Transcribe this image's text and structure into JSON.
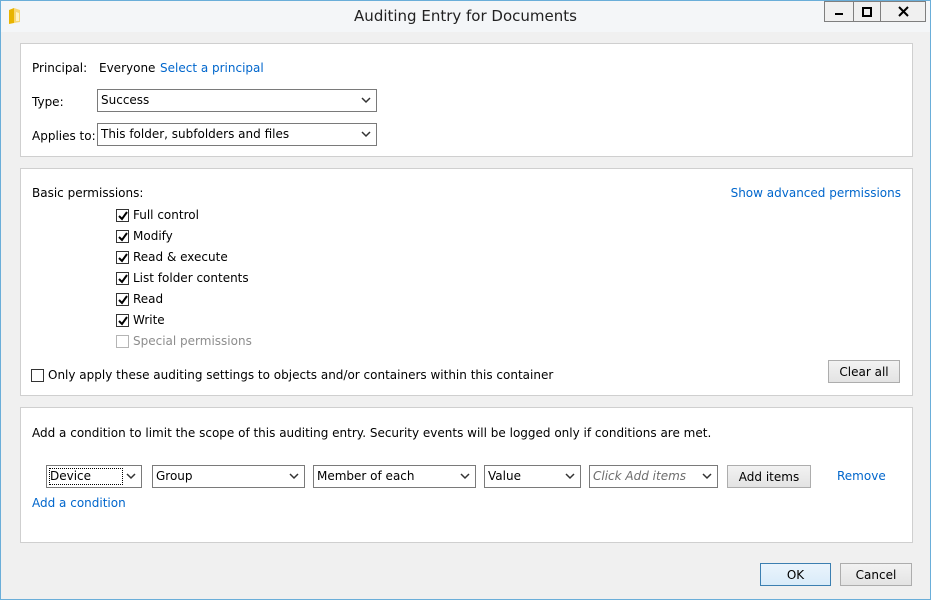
{
  "window": {
    "title": "Auditing Entry for Documents"
  },
  "principal": {
    "label": "Principal:",
    "value": "Everyone",
    "select_link": "Select a principal"
  },
  "type": {
    "label": "Type:",
    "value": "Success"
  },
  "applies_to": {
    "label": "Applies to:",
    "value": "This folder, subfolders and files"
  },
  "permissions": {
    "heading": "Basic permissions:",
    "advanced_link": "Show advanced permissions",
    "items": [
      {
        "label": "Full control",
        "checked": true,
        "disabled": false
      },
      {
        "label": "Modify",
        "checked": true,
        "disabled": false
      },
      {
        "label": "Read & execute",
        "checked": true,
        "disabled": false
      },
      {
        "label": "List folder contents",
        "checked": true,
        "disabled": false
      },
      {
        "label": "Read",
        "checked": true,
        "disabled": false
      },
      {
        "label": "Write",
        "checked": true,
        "disabled": false
      },
      {
        "label": "Special permissions",
        "checked": false,
        "disabled": true
      }
    ],
    "only_apply_label": "Only apply these auditing settings to objects and/or containers within this container",
    "only_apply_checked": false,
    "clear_all_label": "Clear all"
  },
  "condition": {
    "description": "Add a condition to limit the scope of this auditing entry. Security events will be logged only if conditions are met.",
    "attribute_source": "Device",
    "attribute": "Group",
    "operator": "Member of each",
    "value_type": "Value",
    "items_placeholder": "Click Add items",
    "add_items_label": "Add items",
    "remove_label": "Remove",
    "add_condition_link": "Add a condition"
  },
  "footer": {
    "ok_label": "OK",
    "cancel_label": "Cancel"
  },
  "colors": {
    "link": "#0066cc",
    "window_border": "#6aaed9"
  }
}
